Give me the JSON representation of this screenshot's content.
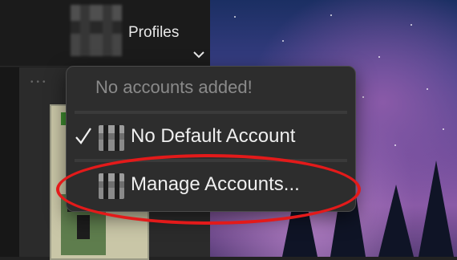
{
  "header": {
    "profiles_label": "Profiles"
  },
  "dropdown": {
    "header_text": "No accounts added!",
    "items": [
      {
        "label": "No Default Account",
        "checked": true
      },
      {
        "label": "Manage Accounts...",
        "checked": false,
        "highlighted": true
      }
    ]
  },
  "colors": {
    "menu_bg": "#2d2d2d",
    "highlight_ring": "#e31a1a",
    "header_text": "#8a8a8a",
    "item_text": "#efefef"
  },
  "icons": [
    "profile-avatar",
    "chevron-down-icon",
    "checkmark-icon",
    "account-avatar-icon"
  ]
}
